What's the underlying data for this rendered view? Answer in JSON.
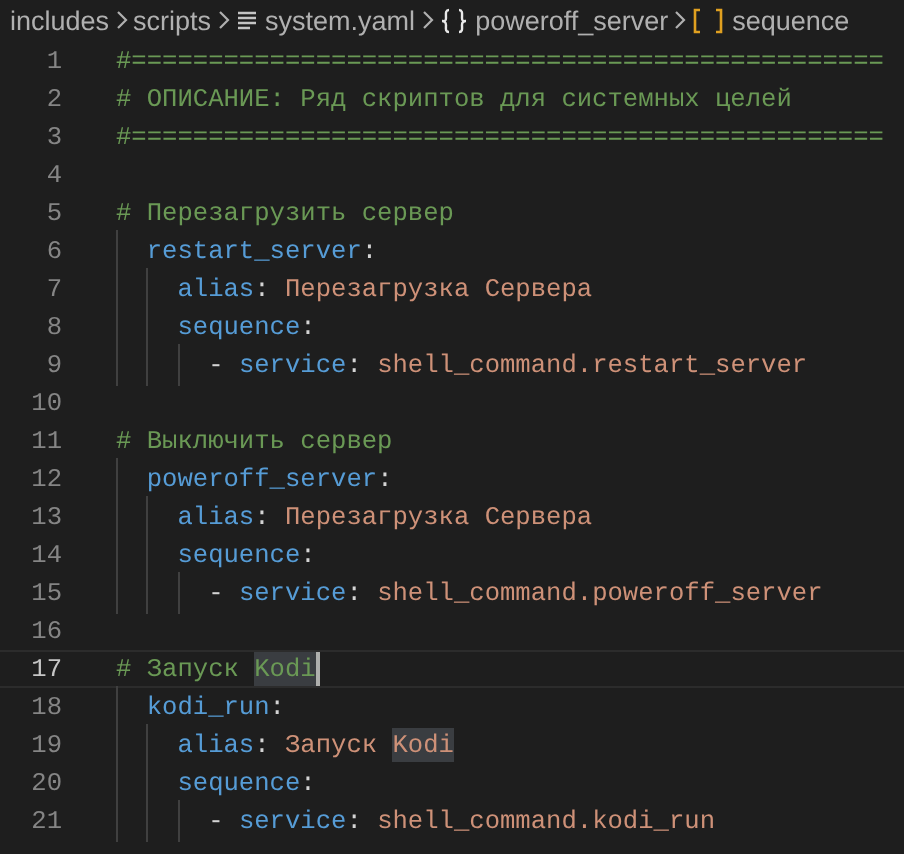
{
  "breadcrumbs": [
    {
      "kind": "folder",
      "label": "includes"
    },
    {
      "kind": "folder",
      "label": "scripts"
    },
    {
      "kind": "file",
      "label": "system.yaml"
    },
    {
      "kind": "object",
      "label": "poweroff_server"
    },
    {
      "kind": "array",
      "label": "sequence"
    }
  ],
  "lines": [
    {
      "number": "1",
      "current": false,
      "tokens": [
        {
          "kind": "comment",
          "text": "#================================================="
        }
      ]
    },
    {
      "number": "2",
      "current": false,
      "tokens": [
        {
          "kind": "comment",
          "text": "# ОПИСАНИЕ: Ряд скриптов для системных целей"
        }
      ]
    },
    {
      "number": "3",
      "current": false,
      "tokens": [
        {
          "kind": "comment",
          "text": "#================================================="
        }
      ]
    },
    {
      "number": "4",
      "current": false
    },
    {
      "number": "5",
      "current": false,
      "tokens": [
        {
          "kind": "comment",
          "text": "# Перезагрузить сервер"
        }
      ],
      "children": [
        {
          "number": "6",
          "current": false,
          "tokens": [
            {
              "kind": "key",
              "text": "restart_server"
            },
            {
              "kind": "punct",
              "text": ":"
            }
          ],
          "children": [
            {
              "number": "7",
              "current": false,
              "tokens": [
                {
                  "kind": "key",
                  "text": "alias"
                },
                {
                  "kind": "punct",
                  "text": ": "
                },
                {
                  "kind": "string",
                  "text": "Перезагрузка Сервера"
                }
              ]
            },
            {
              "number": "8",
              "current": false,
              "tokens": [
                {
                  "kind": "key",
                  "text": "sequence"
                },
                {
                  "kind": "punct",
                  "text": ":"
                }
              ],
              "children": [
                {
                  "number": "9",
                  "current": false,
                  "tokens": [
                    {
                      "kind": "punct",
                      "text": "- "
                    },
                    {
                      "kind": "key",
                      "text": "service"
                    },
                    {
                      "kind": "punct",
                      "text": ": "
                    },
                    {
                      "kind": "string",
                      "text": "shell_command.restart_server"
                    }
                  ]
                }
              ]
            }
          ]
        }
      ]
    },
    {
      "number": "10",
      "current": false
    },
    {
      "number": "11",
      "current": false,
      "tokens": [
        {
          "kind": "comment",
          "text": "# Выключить сервер"
        }
      ],
      "children": [
        {
          "number": "12",
          "current": false,
          "tokens": [
            {
              "kind": "key",
              "text": "poweroff_server"
            },
            {
              "kind": "punct",
              "text": ":"
            }
          ],
          "children": [
            {
              "number": "13",
              "current": false,
              "tokens": [
                {
                  "kind": "key",
                  "text": "alias"
                },
                {
                  "kind": "punct",
                  "text": ": "
                },
                {
                  "kind": "string",
                  "text": "Перезагрузка Сервера"
                }
              ]
            },
            {
              "number": "14",
              "current": false,
              "tokens": [
                {
                  "kind": "key",
                  "text": "sequence"
                },
                {
                  "kind": "punct",
                  "text": ":"
                }
              ],
              "children": [
                {
                  "number": "15",
                  "current": false,
                  "tokens": [
                    {
                      "kind": "punct",
                      "text": "- "
                    },
                    {
                      "kind": "key",
                      "text": "service"
                    },
                    {
                      "kind": "punct",
                      "text": ": "
                    },
                    {
                      "kind": "string",
                      "text": "shell_command.poweroff_server"
                    }
                  ]
                }
              ]
            }
          ]
        }
      ]
    },
    {
      "number": "16",
      "current": false
    },
    {
      "number": "17",
      "current": true,
      "tokens": [
        {
          "kind": "comment",
          "text": "# Запуск "
        },
        {
          "kind": "comment",
          "text": "Kodi",
          "highlighted": true,
          "cursor_after": true
        }
      ],
      "children": [
        {
          "number": "18",
          "current": false,
          "tokens": [
            {
              "kind": "key",
              "text": "kodi_run"
            },
            {
              "kind": "punct",
              "text": ":"
            }
          ],
          "children": [
            {
              "number": "19",
              "current": false,
              "tokens": [
                {
                  "kind": "key",
                  "text": "alias"
                },
                {
                  "kind": "punct",
                  "text": ": "
                },
                {
                  "kind": "string",
                  "text": "Запуск "
                },
                {
                  "kind": "string",
                  "text": "Kodi",
                  "highlighted": true
                }
              ]
            },
            {
              "number": "20",
              "current": false,
              "tokens": [
                {
                  "kind": "key",
                  "text": "sequence"
                },
                {
                  "kind": "punct",
                  "text": ":"
                }
              ],
              "children": [
                {
                  "number": "21",
                  "current": false,
                  "tokens": [
                    {
                      "kind": "punct",
                      "text": "- "
                    },
                    {
                      "kind": "key",
                      "text": "service"
                    },
                    {
                      "kind": "punct",
                      "text": ": "
                    },
                    {
                      "kind": "string",
                      "text": "shell_command.kodi_run"
                    }
                  ]
                }
              ]
            }
          ]
        }
      ]
    }
  ]
}
